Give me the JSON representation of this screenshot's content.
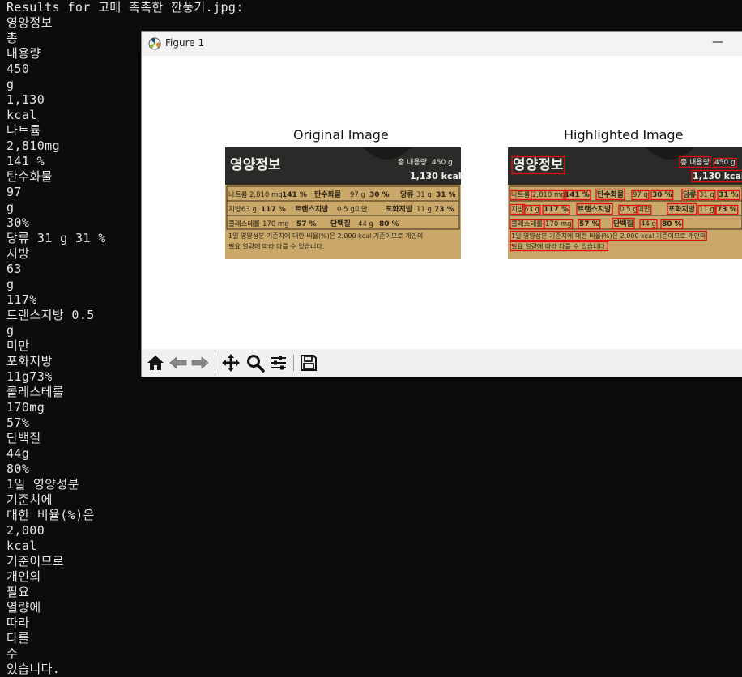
{
  "terminal": {
    "lines": [
      "Results for 고메 촉촉한 깐풍기.jpg:",
      "영양정보",
      "총",
      "내용량",
      "450",
      "g",
      "1,130",
      "kcal",
      "나트륨",
      "2,810mg",
      "141 %",
      "탄수화물",
      "97",
      "g",
      "30%",
      "당류 31 g 31 %",
      "지방",
      "63",
      "g",
      "117%",
      "트랜스지방 0.5",
      "g",
      "미만",
      "포화지방",
      "11g73%",
      "콜레스테롤",
      "170mg",
      "57%",
      "단백질",
      "44g",
      "80%",
      "1일 영양성분",
      "기준치에",
      "대한 비율(%)은",
      "2,000",
      "kcal",
      "기준이므로",
      "개인의",
      "필요",
      "열량에",
      "따라",
      "다를",
      "수",
      "있습니다."
    ]
  },
  "window": {
    "title": "Figure 1",
    "minimize_label": "—"
  },
  "figure": {
    "left_title": "Original Image",
    "right_title": "Highlighted Image",
    "label": {
      "heading": "영양정보",
      "total_label": "총 내용량",
      "total_value": "450 g",
      "kcal": "1,130 kcal",
      "row1": [
        "나트륨",
        "2,810 mg",
        "141 %",
        "탄수화물",
        "97 g",
        "30 %",
        "당류",
        "31 g",
        "31 %"
      ],
      "row2": [
        "지방",
        "63 g",
        "117 %",
        "트랜스지방",
        "0.5 g",
        "미만",
        "포화지방",
        "11 g",
        "73 %"
      ],
      "row3": [
        "콜레스테롤",
        "170 mg",
        "57 %",
        "단백질",
        "44 g",
        "80 %"
      ],
      "note1": "1일 영양성분 기준치에 대한 비율(%)은 2,000 kcal 기준이므로 개인의",
      "note2": "필요 열량에 따라 다를 수 있습니다."
    }
  },
  "toolbar": {
    "buttons": [
      "home-icon",
      "back-icon",
      "forward-icon",
      "pan-icon",
      "zoom-icon",
      "configure-subplots-icon",
      "save-icon"
    ]
  },
  "colors": {
    "terminal_bg": "#0c0c0c",
    "terminal_text": "#e6e6e6",
    "highlight_box": "#e01010",
    "label_bg": "#c9a86a",
    "label_header": "#2a2a28"
  }
}
